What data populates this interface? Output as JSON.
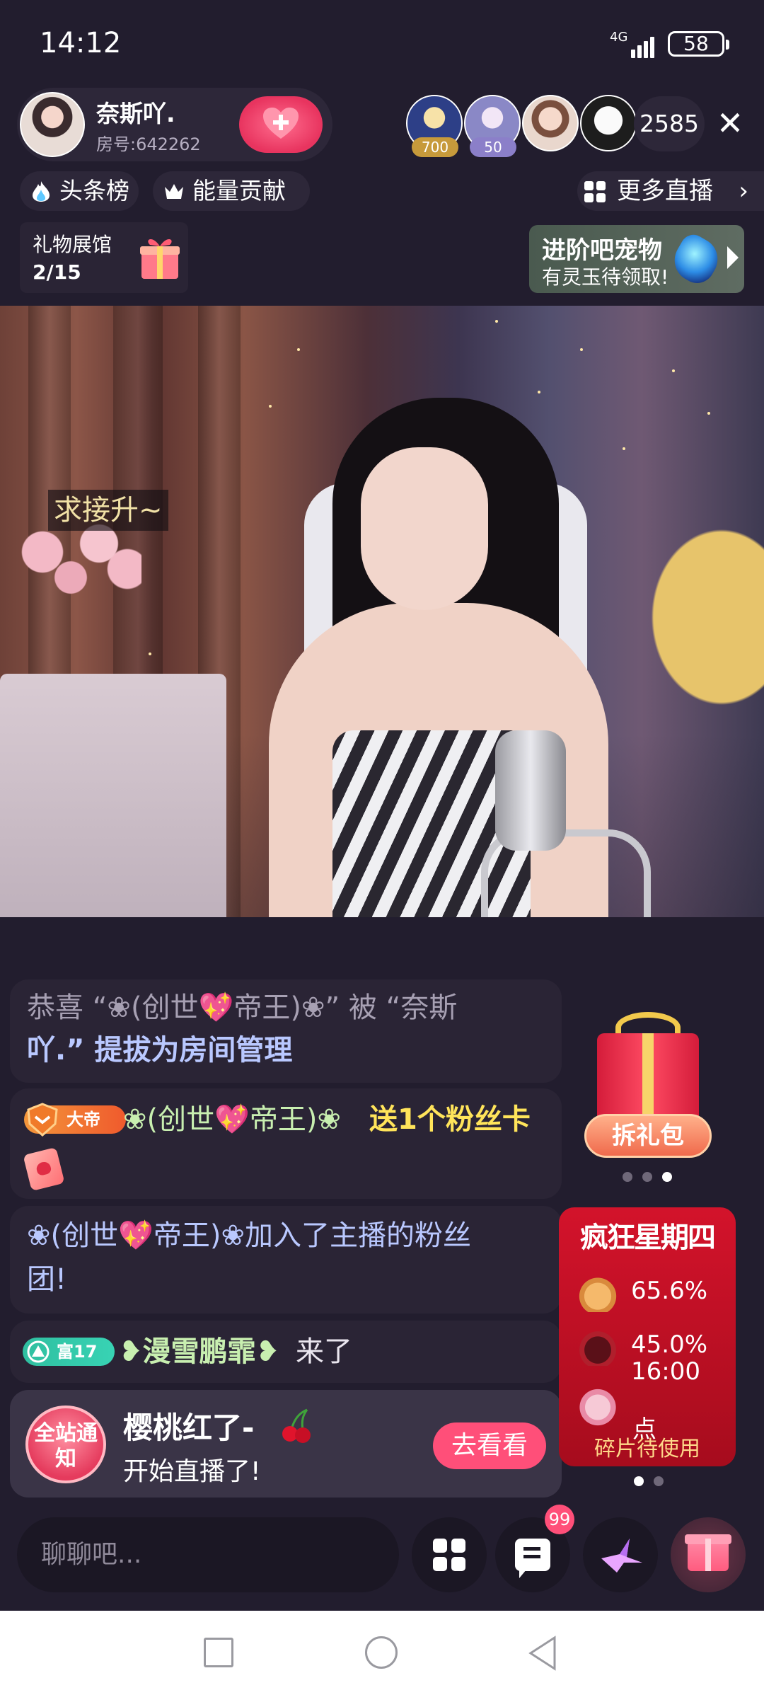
{
  "status_bar": {
    "time": "14:12",
    "network": "4G",
    "battery": "58"
  },
  "header": {
    "host_name": "奈斯吖.",
    "room_number": "房号:642262",
    "follow_icon": "heart-plus-icon",
    "viewers": [
      {
        "badge": "700",
        "badge_color": "#c79a3b"
      },
      {
        "badge": "50",
        "badge_color": "#8b7fc9"
      }
    ],
    "viewer_count": "2585",
    "close_icon": "close-icon"
  },
  "chips": {
    "headline_rank": "头条榜",
    "energy_contribution": "能量贡献",
    "more_live": "更多直播"
  },
  "gift_hall": {
    "title": "礼物展馆",
    "progress": "2/15"
  },
  "pet_banner": {
    "title": "进阶吧宠物",
    "subtitle": "有灵玉待领取!"
  },
  "video": {
    "sticker_text": "求接升~"
  },
  "chat": {
    "msg1": {
      "part1": "恭喜 “❀(创世💖帝王)❀” 被 “奈斯",
      "part2": "吖.” 提拔为房间管理"
    },
    "msg2": {
      "badge": "大帝",
      "user": "❀(创世💖帝王)❀",
      "action": "送1个粉丝卡"
    },
    "msg3": {
      "line1": "❀(创世💖帝王)❀加入了主播的粉丝",
      "line2": "团!"
    },
    "msg4": {
      "badge": "富17",
      "user": "❥漫雪鹏霏❥",
      "action": "来了"
    }
  },
  "notification": {
    "badge": "全站通知",
    "name": "樱桃红了-",
    "subtitle": "开始直播了!",
    "button": "去看看"
  },
  "gift_pack": {
    "button": "拆礼包"
  },
  "crazy_thursday": {
    "title": "疯狂星期四",
    "items": [
      {
        "value": "65.6%"
      },
      {
        "value": "45.0%",
        "time": "16:00"
      }
    ],
    "dot_text": "点",
    "footer": "碎片待使用"
  },
  "bottom_bar": {
    "chat_placeholder": "聊聊吧...",
    "unread_count": "99"
  },
  "colors": {
    "accent": "#ff4f79",
    "background": "#221d2e"
  }
}
